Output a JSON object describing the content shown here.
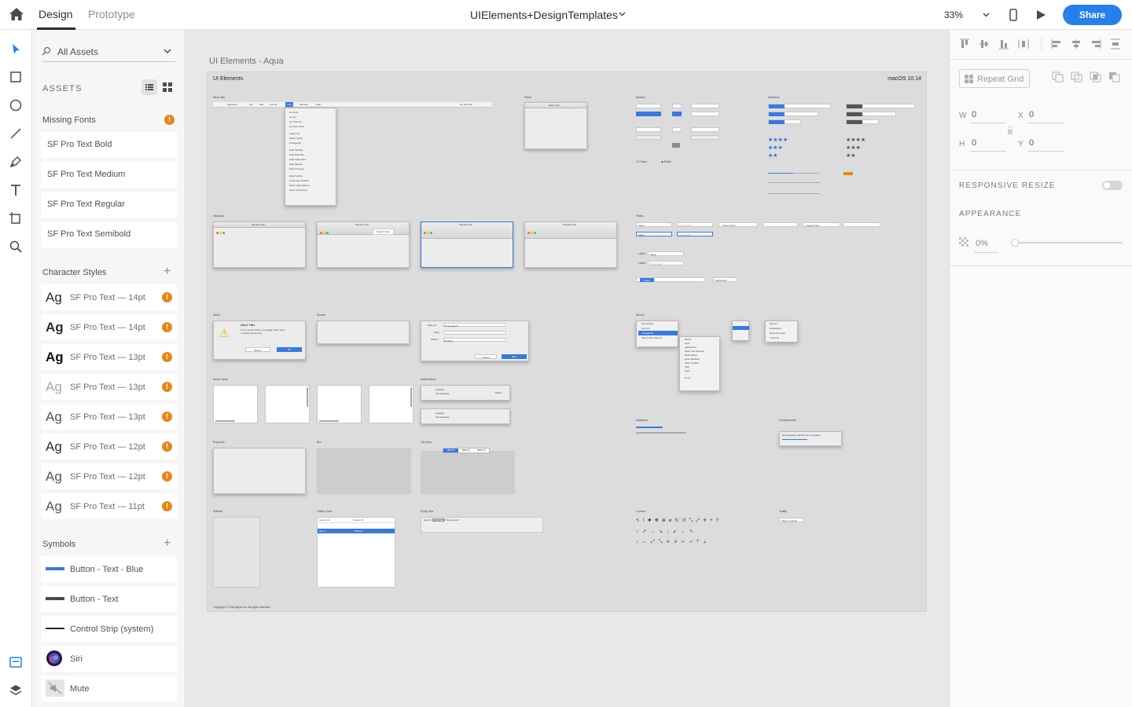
{
  "header": {
    "tabs": [
      "Design",
      "Prototype"
    ],
    "doc_title": "UIElements+DesignTemplates",
    "zoom": "33%",
    "share_label": "Share"
  },
  "left_panel": {
    "search_label": "All Assets",
    "assets_heading": "ASSETS",
    "missing_fonts": {
      "heading": "Missing Fonts",
      "items": [
        "SF Pro Text Bold",
        "SF Pro Text Medium",
        "SF Pro Text Regular",
        "SF Pro Text Semibold"
      ]
    },
    "character_styles": {
      "heading": "Character Styles",
      "items": [
        {
          "sample": "Ag",
          "name": "SF Pro Text — 14pt"
        },
        {
          "sample": "Ag",
          "name": "SF Pro Text — 14pt"
        },
        {
          "sample": "Ag",
          "name": "SF Pro Text — 13pt"
        },
        {
          "sample": "Ag",
          "name": "SF Pro Text — 13pt"
        },
        {
          "sample": "Ag",
          "name": "SF Pro Text — 13pt"
        },
        {
          "sample": "Ag",
          "name": "SF Pro Text — 12pt"
        },
        {
          "sample": "Ag",
          "name": "SF Pro Text — 12pt"
        },
        {
          "sample": "Ag",
          "name": "SF Pro Text — 11pt"
        }
      ]
    },
    "symbols": {
      "heading": "Symbols",
      "items": [
        "Button - Text - Blue",
        "Button - Text",
        "Control Strip (system)",
        "Siri",
        "Mute"
      ]
    }
  },
  "canvas": {
    "artboard_title": "UI Elements - Aqua",
    "board_title": "UI Elements",
    "os_version": "macOS 10.14",
    "sections": {
      "menu_bar": "Menu Bar",
      "panel": "Panel",
      "buttons": "Buttons",
      "selectors": "Selectors",
      "windows": "Windows",
      "fields": "Fields",
      "alerts": "Alerts",
      "sheets": "Sheets",
      "menus": "Menus",
      "scroll_views": "Scroll Views",
      "notifications": "Notifications",
      "indicators": "Indicators",
      "complements": "Complements",
      "popovers": "Popovers",
      "box": "Box",
      "tab_view": "Tab View",
      "sidebar": "Sidebar",
      "outline_view": "Outline View",
      "scope_bar": "Scope Bar",
      "cursors": "Cursors",
      "tooltip": "Tooltip"
    },
    "menubar_items": [
      "AppName",
      "File",
      "Edit",
      "Format",
      "View",
      "Window",
      "Help"
    ],
    "menubar_time": "Tue 9:41 AM",
    "view_menu": [
      "as Icons",
      "as List",
      "as Columns",
      "as Cover Flow",
      "Clean Up",
      "Clean Up By",
      "Arrange By",
      "Hide Tab Bar",
      "Hide Path Bar",
      "Hide Status Bar",
      "Hide Sidebar",
      "Show Preview",
      "Hide Toolbar",
      "Customize Toolbar...",
      "Show View Options",
      "Enter Full Screen"
    ],
    "window_title": "Window Title",
    "panel_title": "Panel Title",
    "search_term": "Search Term",
    "alert_title": "Alert Title",
    "alert_msg": "If you must provide a message, write short, complete sentences.",
    "alert_buttons": [
      "Button",
      "OK"
    ],
    "save_as_label": "Save As:",
    "save_as_value": "Comp.sketch",
    "tags_label": "Tags:",
    "where_label": "Where:",
    "where_value": "Desktop",
    "sheet_buttons": [
      "Cancel",
      "Save"
    ],
    "notif_heading": "Heading",
    "notif_sub": "Sub Heading",
    "notif_btn": "Button",
    "tab_items": [
      "Item 1",
      "Item 2",
      "Item 3"
    ],
    "context_menu": [
      "New Folder",
      "Get Info",
      "Arrange By",
      "Show View Options"
    ],
    "arrange_menu": [
      "Name",
      "Kind",
      "Application",
      "Date Last Opened",
      "Date Added",
      "Date Modified",
      "Date Created",
      "Size",
      "Tags",
      "None"
    ],
    "popup_menu": [
      "Big Sur",
      "Headsberg",
      "Sonoma Coast",
      "Yosemite"
    ],
    "progress_label": "Downloading macOS from Template...",
    "tooltip_text": "This is a tooltip",
    "copyright": "Copyright © 2018 Apple Inc. All rights reserved.",
    "outline_cols": [
      "Column A",
      "Column B"
    ],
    "outline_sel": [
      "Item 2",
      "Attribute"
    ],
    "scope_items": [
      "Search:",
      "This Mac",
      "\"Documents\""
    ],
    "date_value": "01/01/2017",
    "token_label": "Token",
    "value_label": "Value",
    "placeholder_label": "Placeholder",
    "label_text": "Label"
  },
  "right_panel": {
    "repeat_grid": "Repeat Grid",
    "w_label": "W",
    "w_value": "0",
    "h_label": "H",
    "h_value": "0",
    "x_label": "X",
    "x_value": "0",
    "y_label": "Y",
    "y_value": "0",
    "responsive_resize": "RESPONSIVE RESIZE",
    "appearance": "APPEARANCE",
    "opacity": "0%"
  },
  "colors": {
    "accent": "#2680eb",
    "warning": "#e68619",
    "mac_blue": "#3879e0"
  }
}
